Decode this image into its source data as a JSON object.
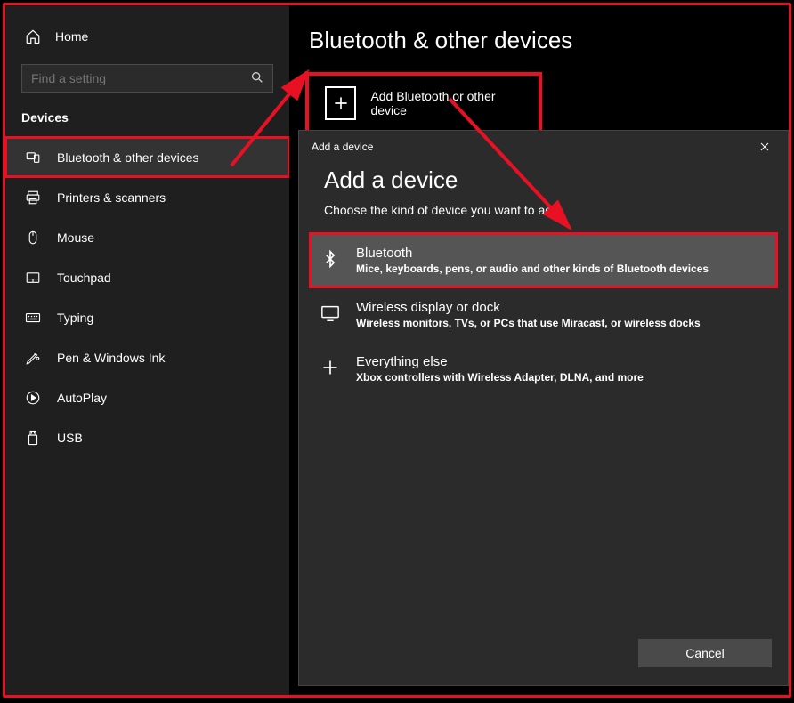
{
  "sidebar": {
    "home_label": "Home",
    "search_placeholder": "Find a setting",
    "section_title": "Devices",
    "items": [
      {
        "label": "Bluetooth & other devices",
        "icon": "bluetooth-devices-icon",
        "active": true
      },
      {
        "label": "Printers & scanners",
        "icon": "printer-icon"
      },
      {
        "label": "Mouse",
        "icon": "mouse-icon"
      },
      {
        "label": "Touchpad",
        "icon": "touchpad-icon"
      },
      {
        "label": "Typing",
        "icon": "keyboard-icon"
      },
      {
        "label": "Pen & Windows Ink",
        "icon": "pen-icon"
      },
      {
        "label": "AutoPlay",
        "icon": "autoplay-icon"
      },
      {
        "label": "USB",
        "icon": "usb-icon"
      }
    ]
  },
  "main": {
    "title": "Bluetooth & other devices",
    "add_button_label": "Add Bluetooth or other device"
  },
  "dialog": {
    "titlebar": "Add a device",
    "heading": "Add a device",
    "subtitle": "Choose the kind of device you want to add",
    "options": [
      {
        "title": "Bluetooth",
        "desc": "Mice, keyboards, pens, or audio and other kinds of Bluetooth devices",
        "icon": "bluetooth-icon",
        "selected": true
      },
      {
        "title": "Wireless display or dock",
        "desc": "Wireless monitors, TVs, or PCs that use Miracast, or wireless docks",
        "icon": "display-icon"
      },
      {
        "title": "Everything else",
        "desc": "Xbox controllers with Wireless Adapter, DLNA, and more",
        "icon": "plus-icon"
      }
    ],
    "cancel_label": "Cancel"
  },
  "annotations": {
    "highlight_color": "#e81123"
  }
}
